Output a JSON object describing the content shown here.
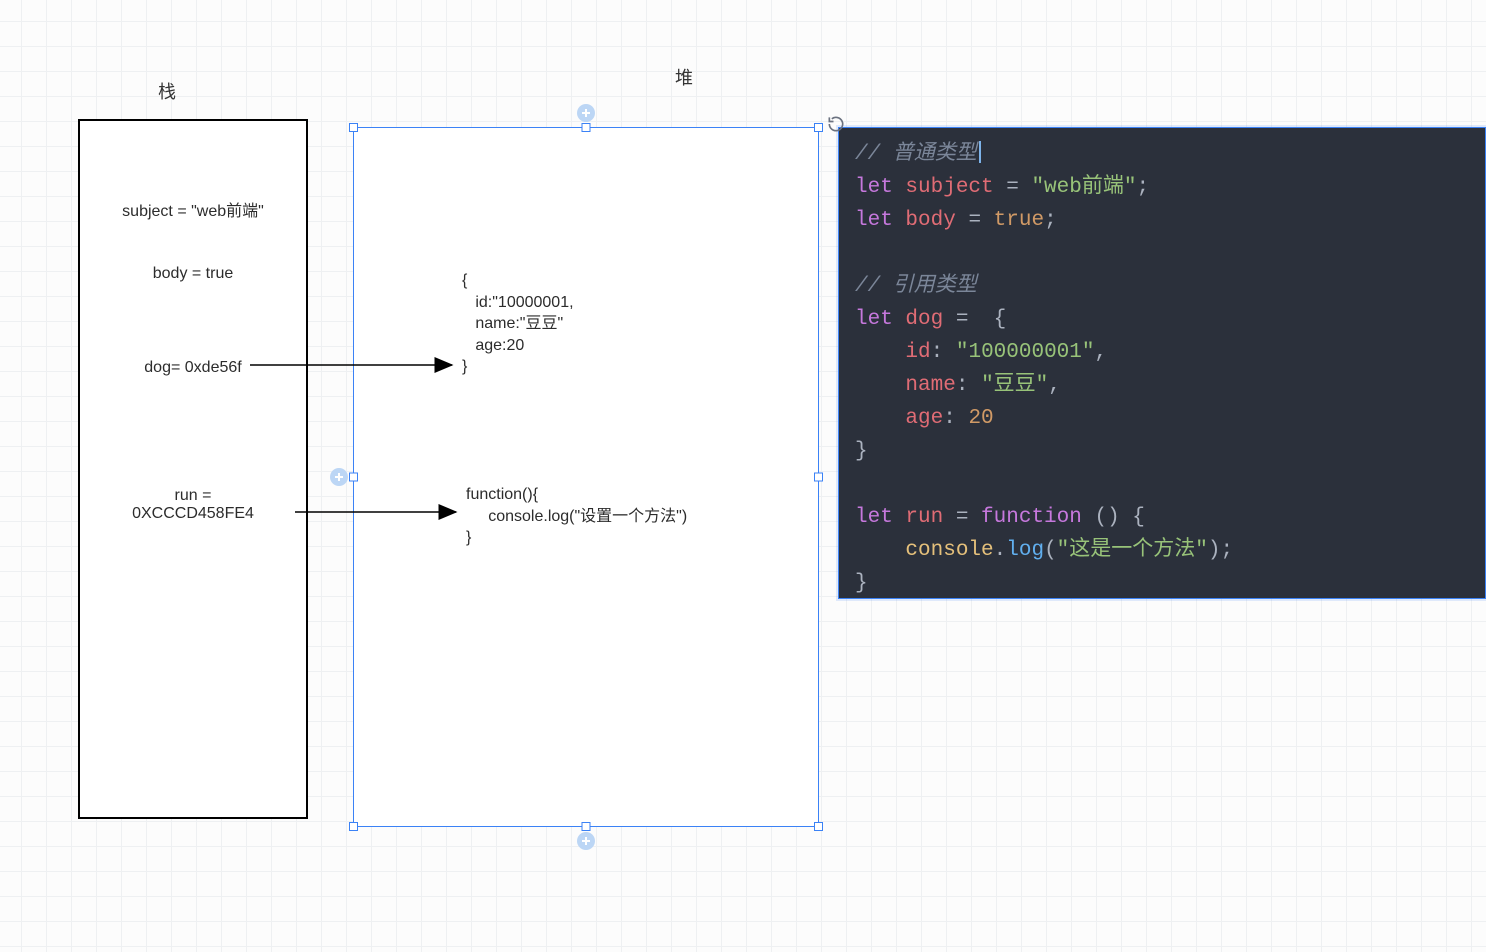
{
  "labels": {
    "stack_title": "栈",
    "heap_title": "堆"
  },
  "stack": {
    "line1": "subject = \"web前端\"",
    "line2": "body = true",
    "line3": "dog= 0xde56f",
    "line4": "run =\n0XCCCD458FE4"
  },
  "heap": {
    "obj_text": "{\n   id:\"10000001,\n   name:\"豆豆\"\n   age:20\n}",
    "fn_text": "function(){\n     console.log(\"设置一个方法\")\n}"
  },
  "code": {
    "c1": "// 普通类型",
    "kw_let": "let",
    "v_subject": "subject",
    "eq": " = ",
    "s_web": "\"web前端\"",
    "semi": ";",
    "v_body": "body",
    "b_true": "true",
    "c2": "// 引用类型",
    "v_dog": "dog",
    "brace_open": " {",
    "p_id": "id",
    "colon": ": ",
    "s_id": "\"100000001\"",
    "comma": ",",
    "p_name": "name",
    "s_name": "\"豆豆\"",
    "p_age": "age",
    "n_age": "20",
    "brace_close": "}",
    "v_run": "run",
    "kw_function": "function",
    "paren": " () {",
    "o_console": "console",
    "dot": ".",
    "m_log": "log",
    "lp": "(",
    "s_msg": "\"这是一个方法\"",
    "rp_semi": ");"
  }
}
